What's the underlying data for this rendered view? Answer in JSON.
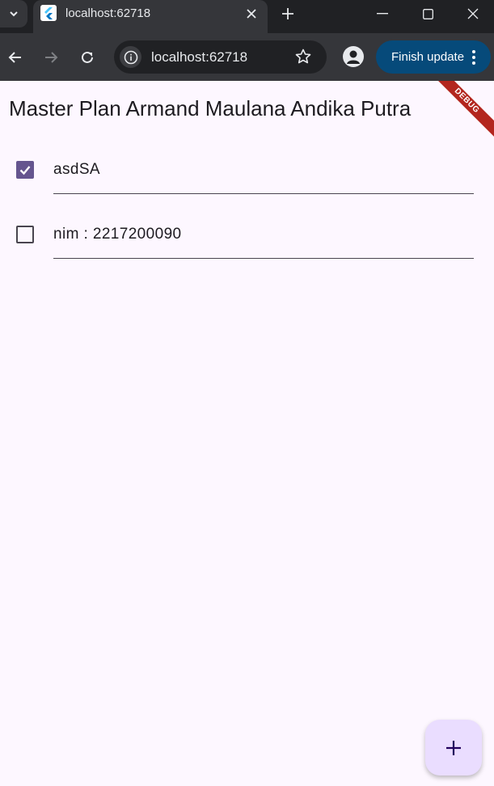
{
  "browser": {
    "tab_title": "localhost:62718",
    "url": "localhost:62718",
    "update_button_label": "Finish update"
  },
  "app": {
    "title": "Master Plan Armand Maulana Andika Putra",
    "debug_banner": "DEBUG",
    "tasks": [
      {
        "description": "asdSA",
        "complete": true
      },
      {
        "description": "nim : 2217200090",
        "complete": false
      }
    ],
    "fab_icon": "add-icon"
  },
  "colors": {
    "accent": "#65558f",
    "fab_background": "#eaddff",
    "page_background": "#fdf7ff",
    "debug_banner": "#b3261e"
  }
}
